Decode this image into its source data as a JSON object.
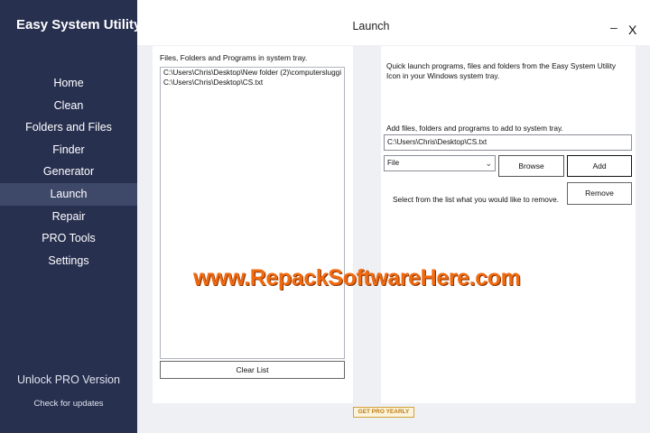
{
  "app": {
    "title": "Easy System Utility"
  },
  "sidebar": {
    "items": [
      {
        "label": "Home"
      },
      {
        "label": "Clean"
      },
      {
        "label": "Folders and Files"
      },
      {
        "label": "Finder"
      },
      {
        "label": "Generator"
      },
      {
        "label": "Launch",
        "active": true
      },
      {
        "label": "Repair"
      },
      {
        "label": "PRO Tools"
      },
      {
        "label": "Settings"
      }
    ],
    "unlock_label": "Unlock PRO Version",
    "check_updates_label": "Check for updates"
  },
  "window": {
    "title": "Launch",
    "minimize_glyph": "–",
    "close_glyph": "X"
  },
  "left_panel": {
    "label": "Files, Folders and Programs in system tray.",
    "items": [
      "C:\\Users\\Chris\\Desktop\\New folder (2)\\computersluggi",
      "C:\\Users\\Chris\\Desktop\\CS.txt"
    ],
    "clear_button": "Clear List"
  },
  "right_panel": {
    "description": "Quick launch programs, files and folders from the Easy System Utility Icon in your Windows system tray.",
    "add_label": "Add files, folders and programs to add to system tray.",
    "path_value": "C:\\Users\\Chris\\Desktop\\CS.txt",
    "type_selected": "File",
    "browse_button": "Browse",
    "add_button": "Add",
    "remove_label": "Select from the list what you would like to remove.",
    "remove_button": "Remove"
  },
  "footer": {
    "get_pro_label": "GET PRO YEARLY"
  },
  "watermark": {
    "text": "www.RepackSoftwareHere.com"
  },
  "colors": {
    "sidebar_bg": "#283050",
    "sidebar_active": "#3e4868",
    "main_bg": "#eef0f4",
    "accent_orange": "#f06a10"
  },
  "icons": {
    "minimize": "minimize-icon",
    "close": "close-icon",
    "dropdown": "chevron-down-icon"
  }
}
